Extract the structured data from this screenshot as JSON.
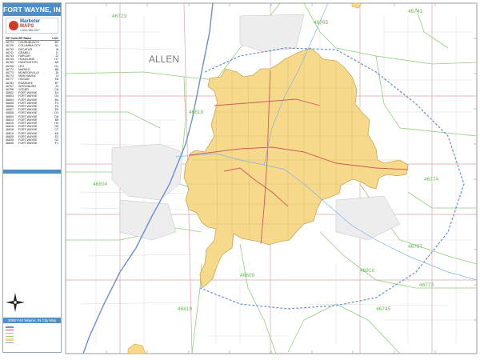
{
  "title": "FORT WAYNE, IN",
  "county_label": "ALLEN",
  "logo": {
    "line1": "Marketer",
    "line2": "MAPS",
    "line3": "1-800-485-2007"
  },
  "zip_table": {
    "headers": [
      "ZIP Code",
      "ZIP Name",
      "LOC"
    ],
    "rows": [
      [
        "46723",
        "CHURUBUSCO",
        "B1"
      ],
      [
        "46725",
        "COLUMBIA CITY",
        "A1"
      ],
      [
        "46733",
        "DECATUR",
        "I6"
      ],
      [
        "46741",
        "GRABILL",
        "I1"
      ],
      [
        "46743",
        "HARLAN",
        "J2"
      ],
      [
        "46745",
        "HOAGLAND",
        "H7"
      ],
      [
        "46750",
        "HUNTINGTON",
        "A5"
      ],
      [
        "46765",
        "LEO",
        "G1"
      ],
      [
        "46772",
        "MARKLE",
        "B8"
      ],
      [
        "46773",
        "MONROEVILLE",
        "J6"
      ],
      [
        "46774",
        "NEW HAVEN",
        "I3"
      ],
      [
        "46777",
        "OSSIAN",
        "E8"
      ],
      [
        "46783",
        "ROANOKE",
        "B7"
      ],
      [
        "46797",
        "WOODBURN",
        "J3"
      ],
      [
        "46798",
        "YODER",
        "C8"
      ],
      [
        "46802",
        "FORT WAYNE",
        "E4"
      ],
      [
        "46803",
        "FORT WAYNE",
        "G4"
      ],
      [
        "46804",
        "FORT WAYNE",
        "B4"
      ],
      [
        "46805",
        "FORT WAYNE",
        "F3"
      ],
      [
        "46806",
        "FORT WAYNE",
        "F5"
      ],
      [
        "46807",
        "FORT WAYNE",
        "E5"
      ],
      [
        "46808",
        "FORT WAYNE",
        "D3"
      ],
      [
        "46809",
        "FORT WAYNE",
        "D6"
      ],
      [
        "46814",
        "FORT WAYNE",
        "B5"
      ],
      [
        "46815",
        "FORT WAYNE",
        "H3"
      ],
      [
        "46816",
        "FORT WAYNE",
        "G5"
      ],
      [
        "46818",
        "FORT WAYNE",
        "C2"
      ],
      [
        "46819",
        "FORT WAYNE",
        "E6"
      ],
      [
        "46825",
        "FORT WAYNE",
        "E2"
      ],
      [
        "46835",
        "FORT WAYNE",
        "G2"
      ],
      [
        "46845",
        "FORT WAYNE",
        "F1"
      ]
    ]
  },
  "legend_title": "2008 Fort Wayne, IN City Map",
  "zip_labels": [
    {
      "text": "46723"
    },
    {
      "text": "46741"
    },
    {
      "text": "46765"
    },
    {
      "text": "46818"
    },
    {
      "text": "46804"
    },
    {
      "text": "46774"
    },
    {
      "text": "46797"
    },
    {
      "text": "46809"
    },
    {
      "text": "46816"
    },
    {
      "text": "46773"
    },
    {
      "text": "46745"
    },
    {
      "text": "46819"
    }
  ],
  "colors": {
    "city_fill": "#f6d98a",
    "accent": "#4f8fc6",
    "highway": "#6b8fd1",
    "zip_boundary": "#8fcf7a",
    "road": "#e0a0a8"
  }
}
